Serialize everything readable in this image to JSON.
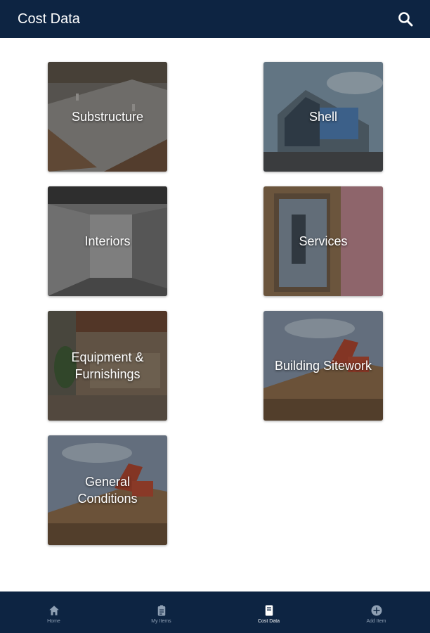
{
  "app_bar": {
    "title": "Cost Data",
    "search_icon": "search-icon"
  },
  "categories": [
    {
      "label": "Substructure"
    },
    {
      "label": "Shell"
    },
    {
      "label": "Interiors"
    },
    {
      "label": "Services"
    },
    {
      "label": "Equipment &\nFurnishings"
    },
    {
      "label": "Building Sitework"
    },
    {
      "label": "General\nConditions"
    }
  ],
  "bottom_nav": [
    {
      "label": "Home",
      "icon": "home-icon",
      "active": false
    },
    {
      "label": "My Items",
      "icon": "clipboard-icon",
      "active": false
    },
    {
      "label": "Cost Data",
      "icon": "book-icon",
      "active": true
    },
    {
      "label": "Add Item",
      "icon": "add-circle-icon",
      "active": false
    }
  ],
  "colors": {
    "header": "#0d2442",
    "nav_active": "#ffffff",
    "nav_inactive": "#8fa0b4"
  }
}
